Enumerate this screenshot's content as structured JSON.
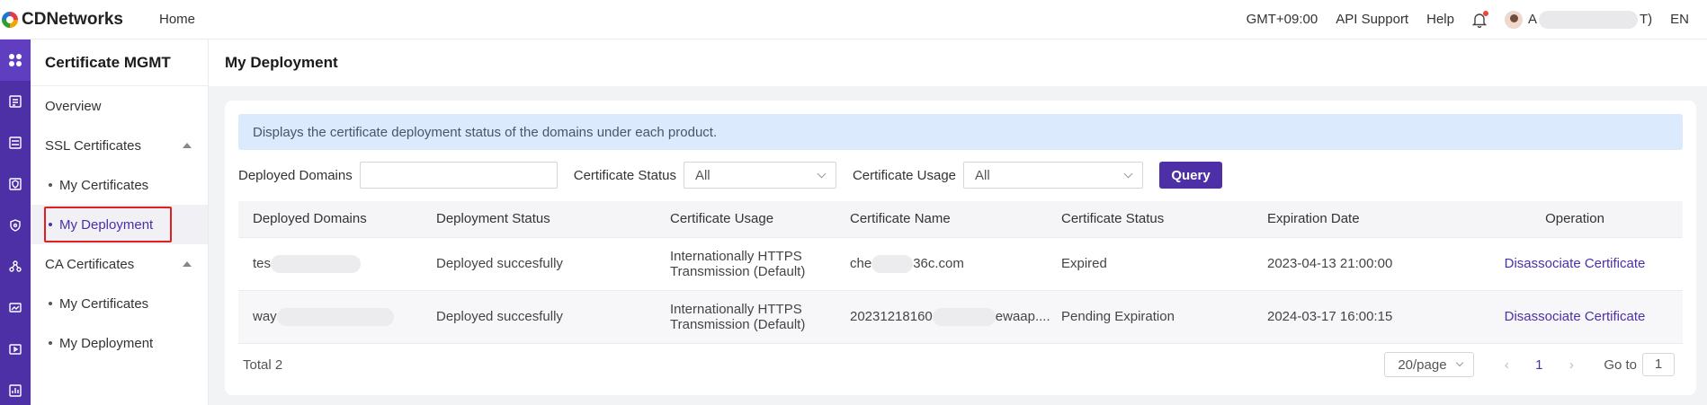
{
  "topbar": {
    "brand": "CDNetworks",
    "home": "Home",
    "timezone": "GMT+09:00",
    "api_support": "API Support",
    "help": "Help",
    "user_initial": "A",
    "user_suffix": "T)",
    "language": "EN"
  },
  "sidebar": {
    "title": "Certificate MGMT",
    "overview": "Overview",
    "ssl_group": "SSL Certificates",
    "ssl_my_certificates": "My Certificates",
    "ssl_my_deployment": "My Deployment",
    "ca_group": "CA Certificates",
    "ca_my_certificates": "My Certificates",
    "ca_my_deployment": "My Deployment"
  },
  "page": {
    "title": "My Deployment",
    "info": "Displays the certificate deployment status of the domains under each product."
  },
  "filters": {
    "domains_label": "Deployed Domains",
    "domains_value": "",
    "status_label": "Certificate Status",
    "status_value": "All",
    "usage_label": "Certificate Usage",
    "usage_value": "All",
    "query": "Query"
  },
  "table": {
    "headers": [
      "Deployed Domains",
      "Deployment Status",
      "Certificate Usage",
      "Certificate Name",
      "Certificate Status",
      "Expiration Date",
      "Operation"
    ],
    "rows": [
      {
        "domain_prefix": "tes",
        "domain_suffix": "",
        "deployment_status": "Deployed succesfully",
        "usage_line1": "Internationally HTTPS",
        "usage_line2": "Transmission (Default)",
        "cert_prefix": "che",
        "cert_suffix": "36c.com",
        "cert_status": "Expired",
        "expiration": "2023-04-13 21:00:00",
        "operation": "Disassociate Certificate"
      },
      {
        "domain_prefix": "way",
        "domain_suffix": "",
        "deployment_status": "Deployed succesfully",
        "usage_line1": "Internationally HTTPS",
        "usage_line2": "Transmission (Default)",
        "cert_prefix": "20231218160",
        "cert_suffix": "ewaap....",
        "cert_status": "Pending Expiration",
        "expiration": "2024-03-17 16:00:15",
        "operation": "Disassociate Certificate"
      }
    ]
  },
  "pagination": {
    "total": "Total 2",
    "page_size": "20/page",
    "current": "1",
    "goto_label": "Go to",
    "goto_value": "1"
  },
  "icons": {
    "rail": [
      "apps-icon",
      "server-icon",
      "server-stack-icon",
      "shield-icon",
      "security-icon",
      "network-icon",
      "monitor-icon",
      "media-icon",
      "report-icon"
    ]
  },
  "colors": {
    "brand": "#4d2fa6",
    "success": "#55b84e",
    "expired": "#e03a3a",
    "pending": "#f07c2a",
    "info_bg": "#dbeafc"
  }
}
